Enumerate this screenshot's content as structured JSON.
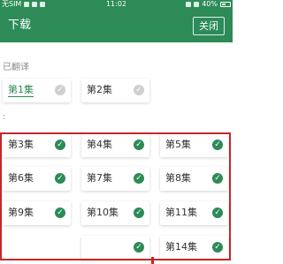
{
  "status_bar": {
    "carrier": "无SIM",
    "time": "11:02",
    "battery": "40%"
  },
  "app_bar": {
    "title": "下载",
    "close_label": "关闭"
  },
  "sections": {
    "translated_label": "已翻译",
    "colon": ":"
  },
  "episodes_translated": [
    {
      "label": "第1集",
      "status": "pending",
      "active": true
    },
    {
      "label": "第2集",
      "status": "pending",
      "active": false
    }
  ],
  "episodes_downloaded": [
    {
      "label": "第3集",
      "status": "done"
    },
    {
      "label": "第4集",
      "status": "done"
    },
    {
      "label": "第5集",
      "status": "done"
    },
    {
      "label": "第6集",
      "status": "done"
    },
    {
      "label": "第7集",
      "status": "done"
    },
    {
      "label": "第8集",
      "status": "done"
    },
    {
      "label": "第9集",
      "status": "done"
    },
    {
      "label": "第10集",
      "status": "done"
    },
    {
      "label": "第11集",
      "status": "done"
    },
    {
      "label": "",
      "status": "done"
    },
    {
      "label": "第14集",
      "status": "done"
    }
  ],
  "colors": {
    "primary": "#2c8b57",
    "highlight": "#c62828",
    "pending": "#cfcfcf"
  },
  "icons": {
    "check": "check-circle-icon"
  }
}
